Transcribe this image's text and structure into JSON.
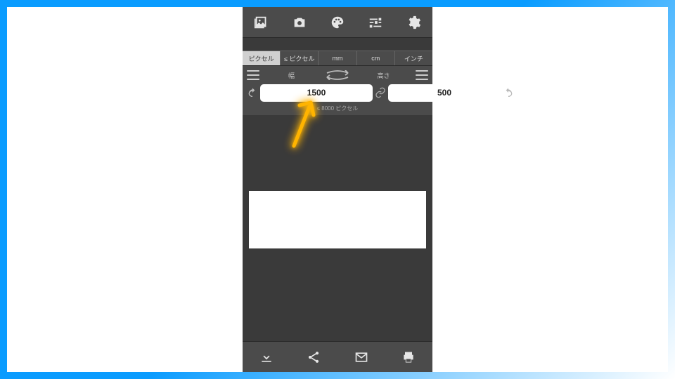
{
  "top_toolbar": {
    "icons": [
      "gallery-icon",
      "camera-icon",
      "palette-icon",
      "sliders-icon",
      "settings-icon"
    ]
  },
  "unit_tabs": {
    "items": [
      {
        "label": "ピクセル",
        "active": true
      },
      {
        "label": "≤ ピクセル",
        "active": false
      },
      {
        "label": "mm",
        "active": false
      },
      {
        "label": "cm",
        "active": false
      },
      {
        "label": "インチ",
        "active": false
      }
    ]
  },
  "dimensions": {
    "width_label": "幅",
    "height_label": "高さ",
    "width_value": "1500",
    "height_value": "500",
    "hint": "≤ 8000 ピクセル"
  },
  "bottom_toolbar": {
    "icons": [
      "download-icon",
      "share-icon",
      "email-icon",
      "print-icon"
    ]
  }
}
